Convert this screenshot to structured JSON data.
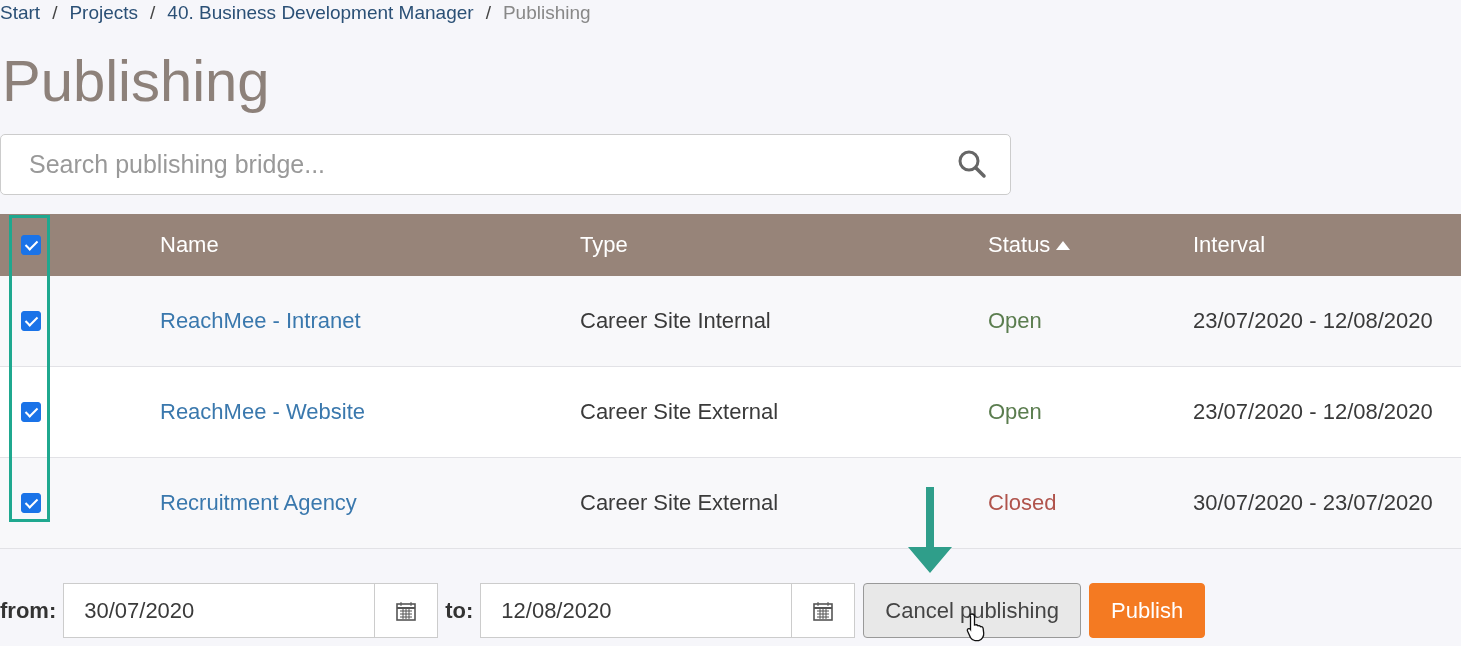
{
  "breadcrumb": [
    {
      "label": "Start",
      "current": false
    },
    {
      "label": "Projects",
      "current": false
    },
    {
      "label": "40. Business Development Manager",
      "current": false
    },
    {
      "label": "Publishing",
      "current": true
    }
  ],
  "separator": "/",
  "title": "Publishing",
  "search": {
    "placeholder": "Search publishing bridge..."
  },
  "table": {
    "select_all_checked": true,
    "columns": [
      {
        "label": "Name",
        "sorted": false
      },
      {
        "label": "Type",
        "sorted": false
      },
      {
        "label": "Status",
        "sorted": true
      },
      {
        "label": "Interval",
        "sorted": false
      }
    ],
    "rows": [
      {
        "checked": true,
        "name": "ReachMee - Intranet",
        "type": "Career Site Internal",
        "status": "Open",
        "color": "#5b7d4f",
        "interval": "23/07/2020 - 12/08/2020"
      },
      {
        "checked": true,
        "name": "ReachMee - Website",
        "type": "Career Site External",
        "status": "Open",
        "color": "#5b7d4f",
        "interval": "23/07/2020 - 12/08/2020"
      },
      {
        "checked": true,
        "name": "Recruitment Agency",
        "type": "Career Site External",
        "status": "Closed",
        "color": "#b0544c",
        "interval": "30/07/2020 - 23/07/2020"
      }
    ]
  },
  "footer": {
    "from_label": "from:",
    "from_value": "30/07/2020",
    "to_label": "to:",
    "to_value": "12/08/2020",
    "buttons": [
      {
        "label": "Cancel publishing",
        "kind": "secondary"
      },
      {
        "label": "Publish",
        "kind": "primary"
      }
    ]
  }
}
